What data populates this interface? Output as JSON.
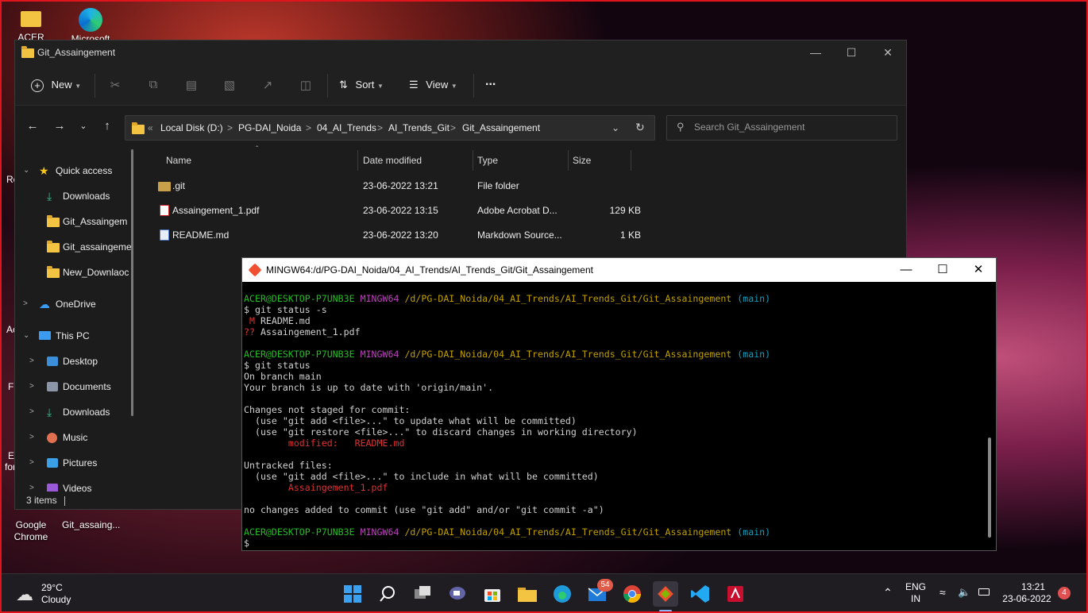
{
  "desktop": {
    "icons": [
      {
        "label": "ACER",
        "name": "acer-folder"
      },
      {
        "label": "Microsoft",
        "name": "edge-shortcut"
      },
      {
        "label": "Google Chrome",
        "name": "chrome-shortcut"
      },
      {
        "label": "Git_assaing...",
        "name": "git-folder-shortcut"
      }
    ],
    "left_edge_labels": [
      "Re",
      "Ac",
      "Fi",
      "E",
      "for"
    ]
  },
  "explorer": {
    "title": "Git_Assaingement",
    "toolbar": {
      "new": "New",
      "sort": "Sort",
      "view": "View",
      "more": "..."
    },
    "breadcrumb": [
      "Local Disk (D:)",
      "PG-DAI_Noida",
      "04_AI_Trends",
      "AI_Trends_Git",
      "Git_Assaingement"
    ],
    "search_placeholder": "Search Git_Assaingement",
    "nav": {
      "quick_access": "Quick access",
      "qa_items": [
        "Downloads",
        "Git_Assaingem",
        "Git_assaingeme",
        "New_Downlaoc"
      ],
      "onedrive": "OneDrive",
      "this_pc": "This PC",
      "pc_items": [
        "Desktop",
        "Documents",
        "Downloads",
        "Music",
        "Pictures",
        "Videos"
      ]
    },
    "columns": {
      "name": "Name",
      "date": "Date modified",
      "type": "Type",
      "size": "Size"
    },
    "files": [
      {
        "name": ".git",
        "date": "23-06-2022 13:21",
        "type": "File folder",
        "size": ""
      },
      {
        "name": "Assaingement_1.pdf",
        "date": "23-06-2022 13:15",
        "type": "Adobe Acrobat D...",
        "size": "129 KB"
      },
      {
        "name": "README.md",
        "date": "23-06-2022 13:20",
        "type": "Markdown Source...",
        "size": "1 KB"
      }
    ],
    "status": "3 items"
  },
  "terminal": {
    "title": "MINGW64:/d/PG-DAI_Noida/04_AI_Trends/AI_Trends_Git/Git_Assaingement",
    "prompt_user": "ACER@DESKTOP-P7UNB3E",
    "prompt_sys": "MINGW64",
    "prompt_path": "/d/PG-DAI_Noida/04_AI_Trends/AI_Trends_Git/Git_Assaingement",
    "prompt_branch": "(main)",
    "cmd1": "$ git status -s",
    "s1a": " M",
    "s1b": " README.md",
    "s2a": "??",
    "s2b": " Assaingement_1.pdf",
    "cmd2": "$ git status",
    "l1": "On branch main",
    "l2": "Your branch is up to date with 'origin/main'.",
    "l3": "Changes not staged for commit:",
    "l4": "  (use \"git add <file>...\" to update what will be committed)",
    "l5": "  (use \"git restore <file>...\" to discard changes in working directory)",
    "l6": "        modified:   README.md",
    "l7": "Untracked files:",
    "l8": "  (use \"git add <file>...\" to include in what will be committed)",
    "l9": "        Assaingement_1.pdf",
    "l10": "no changes added to commit (use \"git add\" and/or \"git commit -a\")",
    "last": "$"
  },
  "taskbar": {
    "weather_temp": "29°C",
    "weather_desc": "Cloudy",
    "badge_mail": "54",
    "lang1": "ENG",
    "lang2": "IN",
    "time": "13:21",
    "date": "23-06-2022",
    "notif": "4"
  }
}
